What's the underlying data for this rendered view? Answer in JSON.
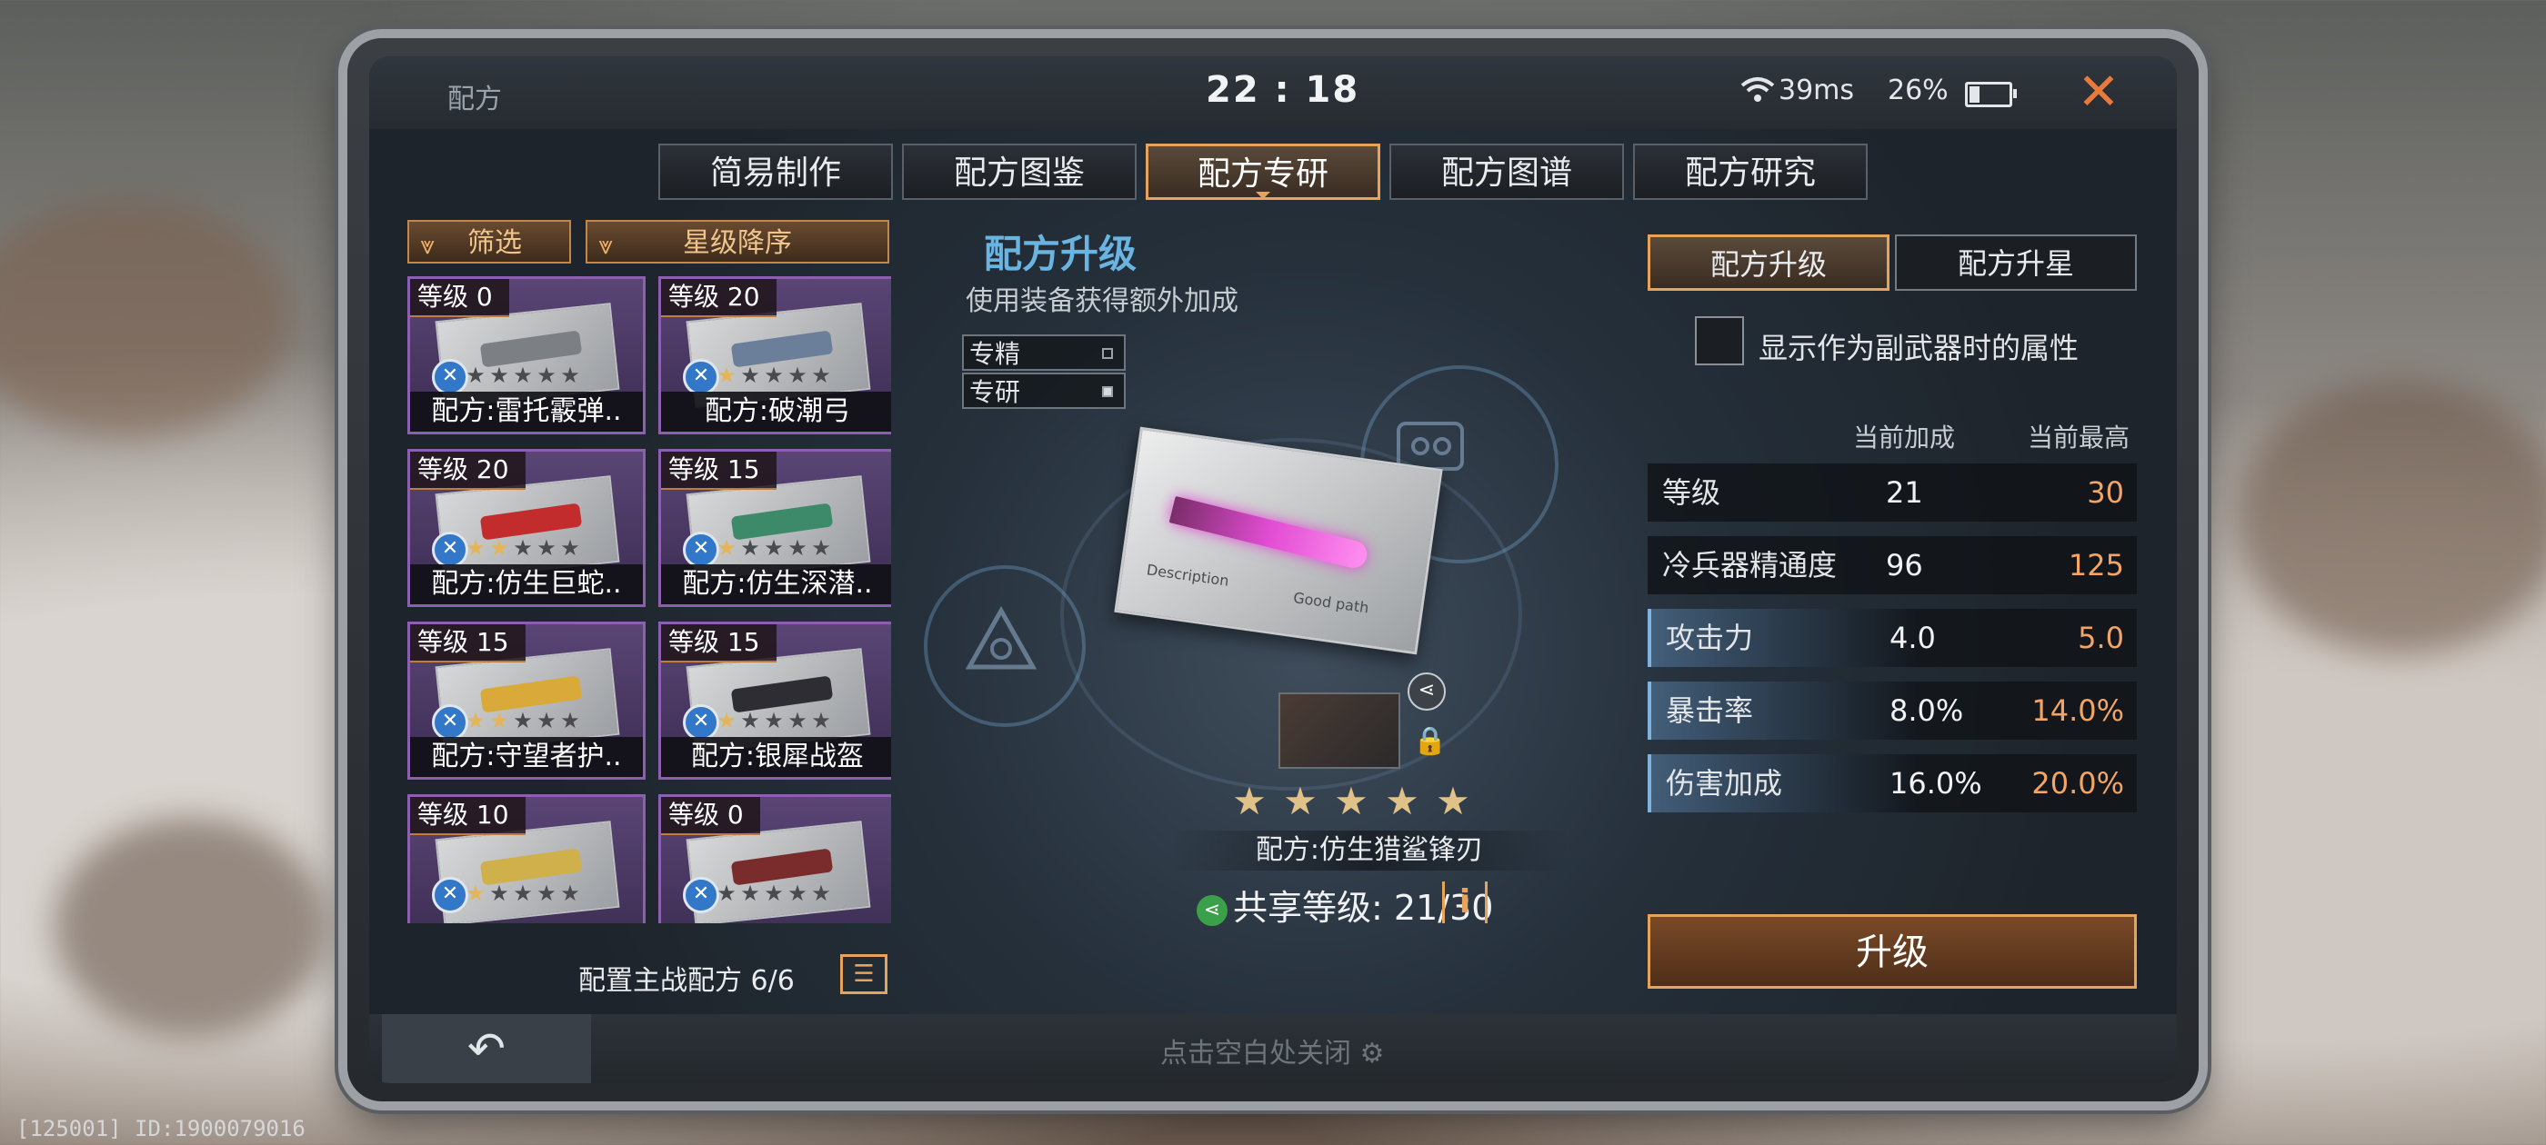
{
  "window": {
    "title": "配方",
    "clock": "22 : 18",
    "ping": "39ms",
    "battery": "26%",
    "battery_level": 0.26,
    "close_label": "✕"
  },
  "tabs": [
    {
      "label": "简易制作",
      "active": false
    },
    {
      "label": "配方图鉴",
      "active": false
    },
    {
      "label": "配方专研",
      "active": true
    },
    {
      "label": "配方图谱",
      "active": false
    },
    {
      "label": "配方研究",
      "active": false
    }
  ],
  "left": {
    "filter_label": "筛选",
    "sort_label": "星级降序",
    "cards": [
      {
        "level": "等级 0",
        "name": "配方:雷托霰弹..",
        "stars_on": 0,
        "accent": "#7c7f84"
      },
      {
        "level": "等级 20",
        "name": "配方:破潮弓",
        "stars_on": 1,
        "accent": "#6b7e9a"
      },
      {
        "level": "等级 20",
        "name": "配方:仿生巨蛇..",
        "stars_on": 2,
        "accent": "#c32c2c"
      },
      {
        "level": "等级 15",
        "name": "配方:仿生深潜..",
        "stars_on": 1,
        "accent": "#3c8a6a"
      },
      {
        "level": "等级 15",
        "name": "配方:守望者护..",
        "stars_on": 2,
        "accent": "#d9a93a"
      },
      {
        "level": "等级 15",
        "name": "配方:银犀战盔",
        "stars_on": 1,
        "accent": "#2d2d33"
      },
      {
        "level": "等级 10",
        "name": "",
        "stars_on": 1,
        "accent": "#d0b04a"
      },
      {
        "level": "等级 0",
        "name": "",
        "stars_on": 0,
        "accent": "#7a2c2c"
      }
    ],
    "loadout_label": "配置主战配方 6/6",
    "loadout_icon": "clipboard-icon"
  },
  "center": {
    "title": "配方升级",
    "subtitle": "使用装备获得额外加成",
    "legend": [
      {
        "label": "专精",
        "filled": false
      },
      {
        "label": "专研",
        "filled": true
      }
    ],
    "paper_text_1": "Description",
    "paper_text_2": "Good path",
    "item_name": "配方:仿生猎鲨锋刃",
    "stars": 5,
    "share_label": "共享等级:",
    "share_value": "21/30",
    "info_label": "i"
  },
  "right": {
    "subtabs": [
      {
        "label": "配方升级",
        "active": true
      },
      {
        "label": "配方升星",
        "active": false
      }
    ],
    "checkbox_label": "显示作为副武器时的属性",
    "col_current": "当前加成",
    "col_max": "当前最高",
    "stats": [
      {
        "name": "等级",
        "current": "21",
        "max": "30",
        "highlight": false
      },
      {
        "name": "冷兵器精通度",
        "current": "96",
        "max": "125",
        "highlight": false
      },
      {
        "name": "攻击力",
        "current": "4.0",
        "max": "5.0",
        "highlight": true
      },
      {
        "name": "暴击率",
        "current": "8.0%",
        "max": "14.0%",
        "highlight": true
      },
      {
        "name": "伤害加成",
        "current": "16.0%",
        "max": "20.0%",
        "highlight": true
      }
    ],
    "upgrade_label": "升级"
  },
  "bottom": {
    "back_icon": "back-arrow-icon",
    "close_hint": "点击空白处关闭 ⚙"
  },
  "debug_text": "[125001] ID:1900079016"
}
